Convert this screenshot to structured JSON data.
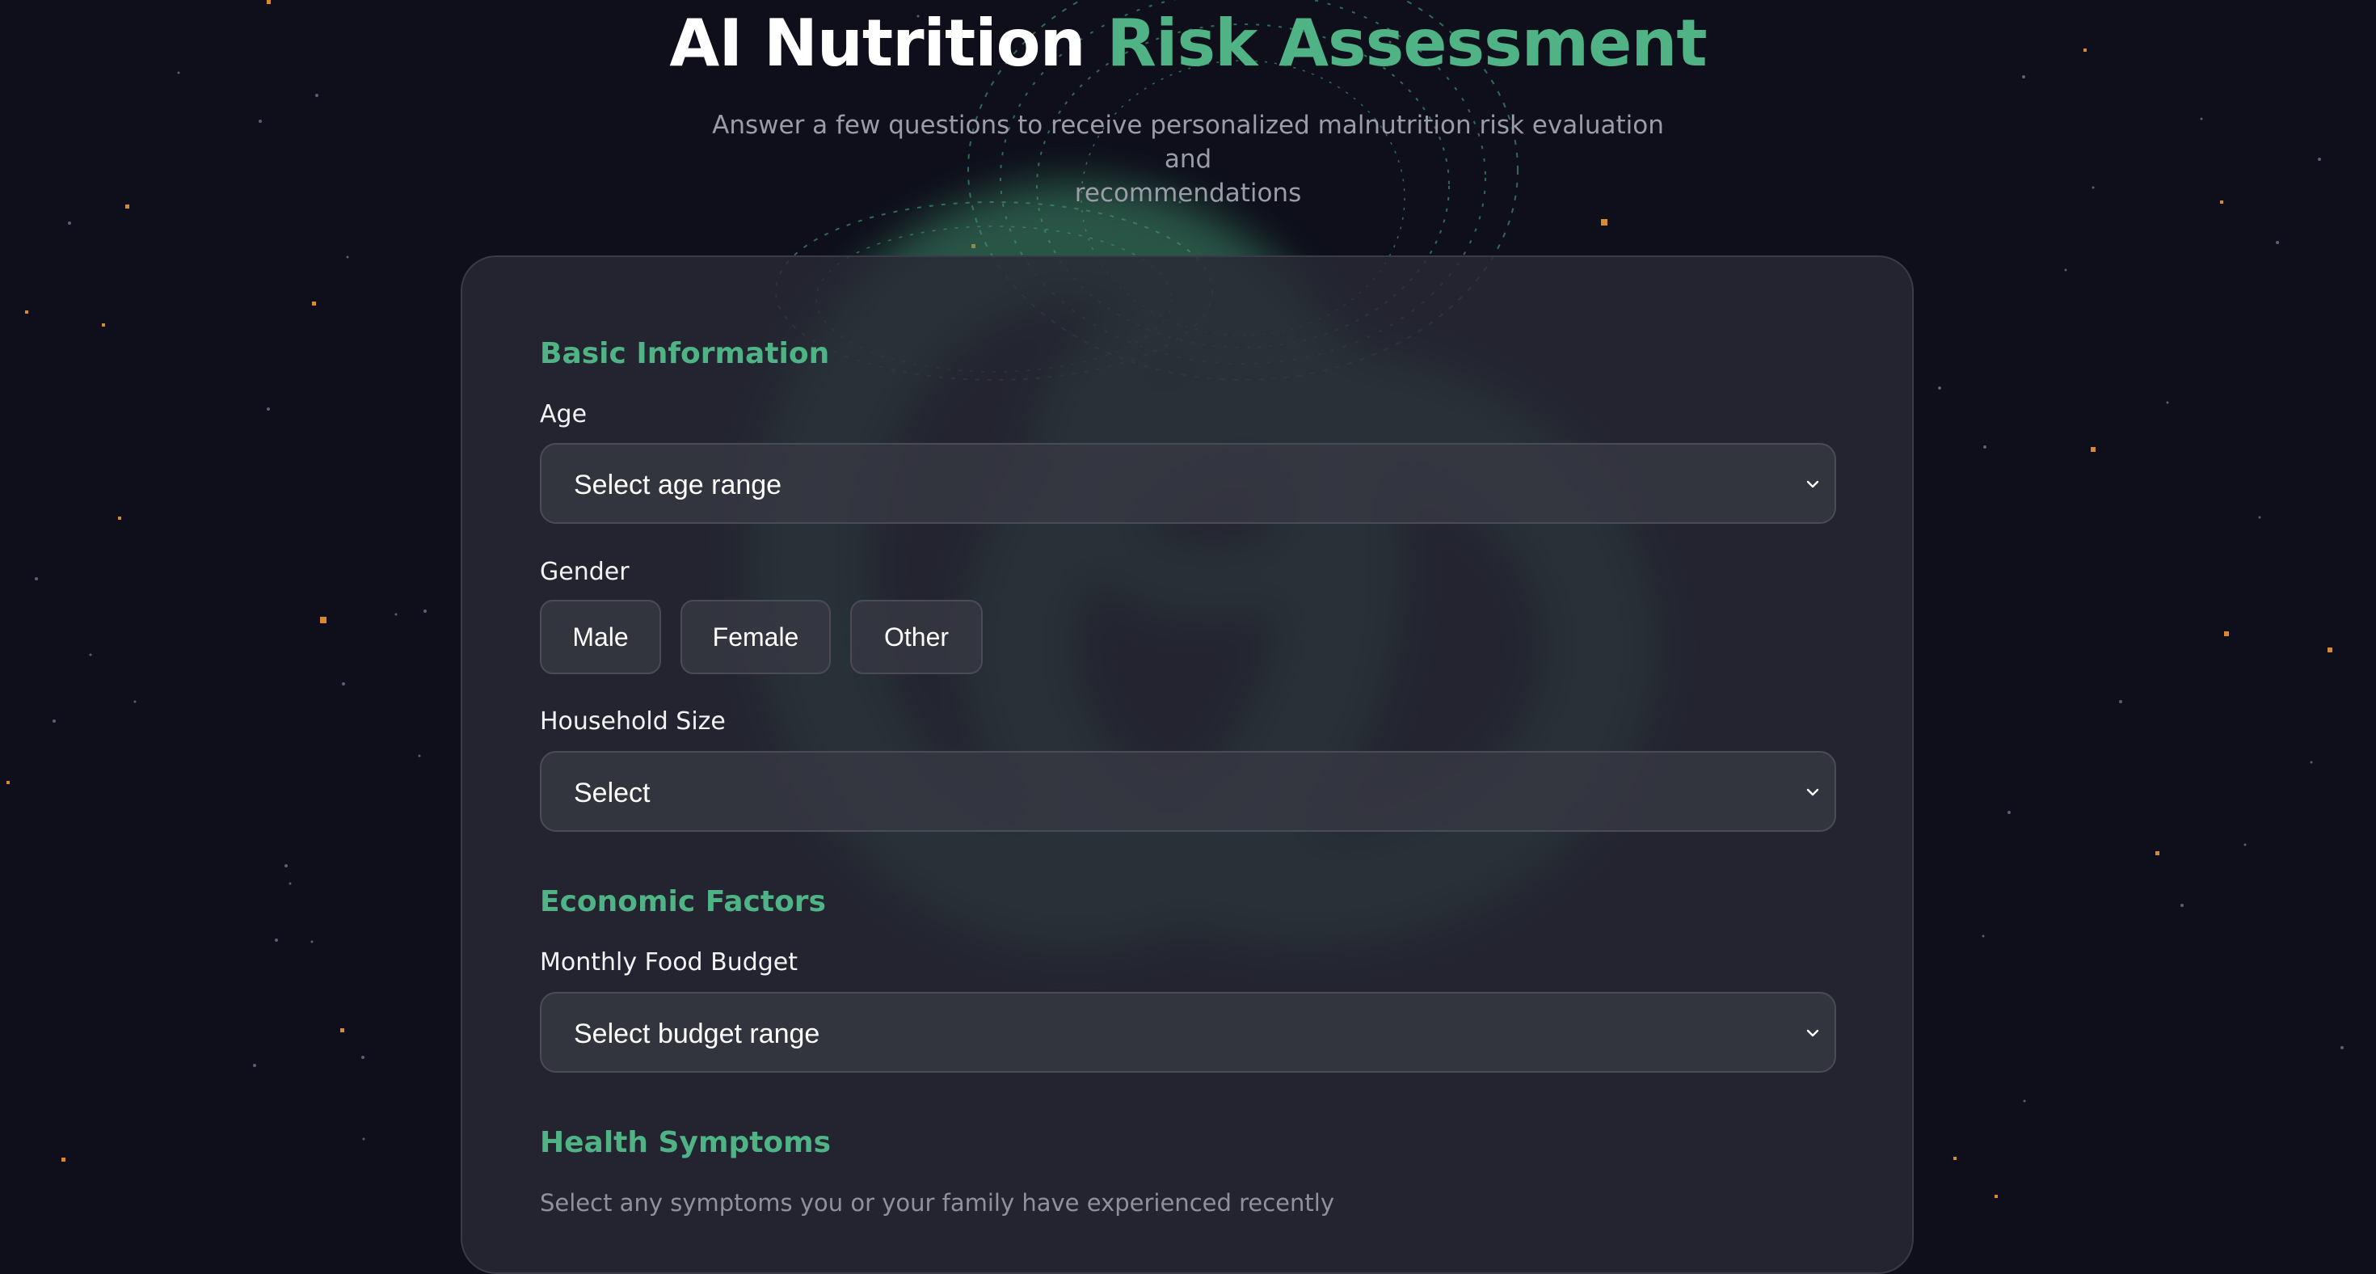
{
  "header": {
    "title_part1": "AI Nutrition",
    "title_part2": "Risk Assessment",
    "subtitle_line1": "Answer a few questions to receive personalized malnutrition risk evaluation and",
    "subtitle_line2": "recommendations"
  },
  "colors": {
    "background": "#0e0f1a",
    "accent": "#4fb386",
    "star": "#d98a2b",
    "card": "#282934"
  },
  "form": {
    "basic_info": {
      "title": "Basic Information",
      "age": {
        "label": "Age",
        "value": "Select age range",
        "icon": "chevron-down-icon"
      },
      "gender": {
        "label": "Gender",
        "options": [
          "Male",
          "Female",
          "Other"
        ]
      },
      "household_size": {
        "label": "Household Size",
        "value": "Select",
        "icon": "chevron-down-icon"
      }
    },
    "economic": {
      "title": "Economic Factors",
      "budget": {
        "label": "Monthly Food Budget",
        "value": "Select budget range",
        "icon": "chevron-down-icon"
      }
    },
    "health": {
      "title": "Health Symptoms",
      "hint": "Select any symptoms you or your family have experienced recently"
    }
  }
}
